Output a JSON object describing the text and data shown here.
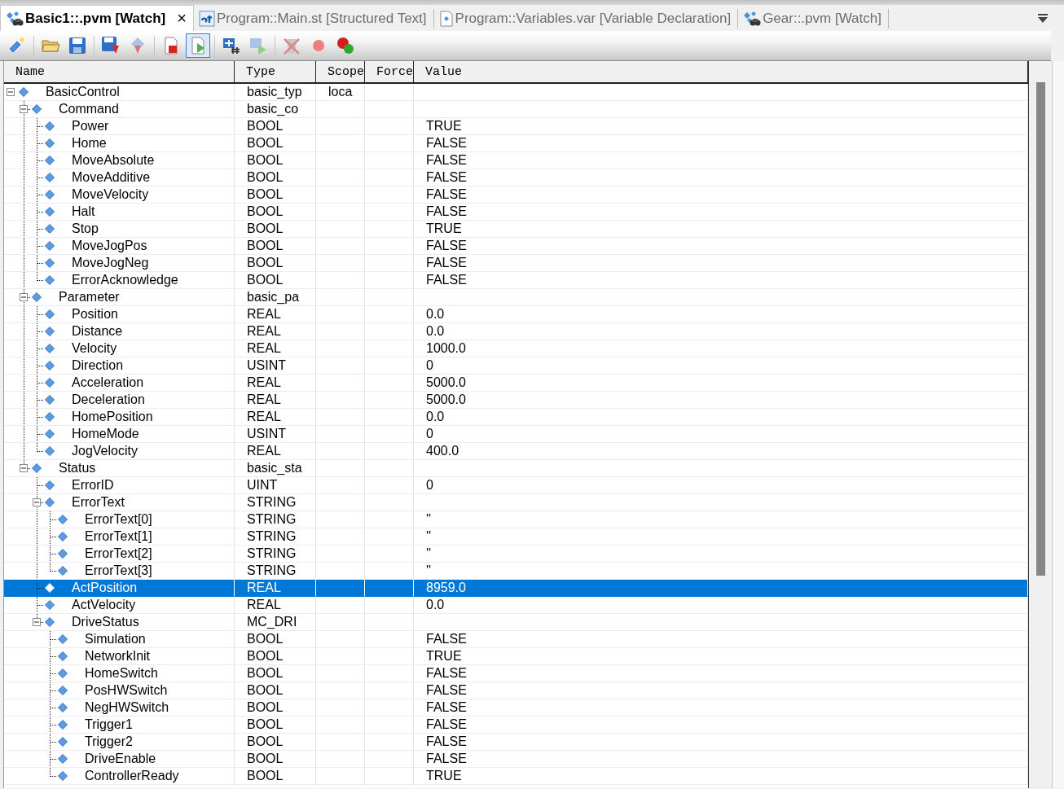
{
  "tabs": [
    {
      "label": "Basic1::.pvm [Watch]",
      "kind": "watch",
      "selected": true,
      "close": "×"
    },
    {
      "label": "Program::Main.st [Structured Text]",
      "kind": "st",
      "selected": false
    },
    {
      "label": "Program::Variables.var [Variable Declaration]",
      "kind": "var",
      "selected": false
    },
    {
      "label": "Gear::.pvm [Watch]",
      "kind": "watch",
      "selected": false
    }
  ],
  "toolbar": [
    {
      "kind": "add-variable",
      "active": false
    },
    {
      "kind": "separator"
    },
    {
      "kind": "open",
      "active": false
    },
    {
      "kind": "save",
      "active": false
    },
    {
      "kind": "separator"
    },
    {
      "kind": "save-down",
      "active": false
    },
    {
      "kind": "download",
      "active": false
    },
    {
      "kind": "separator"
    },
    {
      "kind": "stop-page",
      "active": false
    },
    {
      "kind": "run-page",
      "active": true
    },
    {
      "kind": "separator"
    },
    {
      "kind": "variables",
      "active": false
    },
    {
      "kind": "run-variables",
      "active": false
    },
    {
      "kind": "separator"
    },
    {
      "kind": "delete",
      "active": false
    },
    {
      "kind": "record",
      "active": false
    },
    {
      "kind": "multi",
      "active": false
    }
  ],
  "table": {
    "columns": [
      "Name",
      "Type",
      "Scope",
      "Force",
      "Value"
    ],
    "rows": [
      {
        "name": "BasicControl",
        "type": "basic_typ",
        "scope": "loca",
        "selected": false,
        "expanded": true,
        "children": [
          {
            "name": "Command",
            "type": "basic_co",
            "selected": false,
            "expanded": true,
            "children": [
              {
                "name": "Power",
                "type": "BOOL",
                "value": "TRUE",
                "selected": false
              },
              {
                "name": "Home",
                "type": "BOOL",
                "value": "FALSE",
                "selected": false
              },
              {
                "name": "MoveAbsolute",
                "type": "BOOL",
                "value": "FALSE",
                "selected": false
              },
              {
                "name": "MoveAdditive",
                "type": "BOOL",
                "value": "FALSE",
                "selected": false
              },
              {
                "name": "MoveVelocity",
                "type": "BOOL",
                "value": "FALSE",
                "selected": false
              },
              {
                "name": "Halt",
                "type": "BOOL",
                "value": "FALSE",
                "selected": false
              },
              {
                "name": "Stop",
                "type": "BOOL",
                "value": "TRUE",
                "selected": false
              },
              {
                "name": "MoveJogPos",
                "type": "BOOL",
                "value": "FALSE",
                "selected": false
              },
              {
                "name": "MoveJogNeg",
                "type": "BOOL",
                "value": "FALSE",
                "selected": false
              },
              {
                "name": "ErrorAcknowledge",
                "type": "BOOL",
                "value": "FALSE",
                "selected": false
              }
            ]
          },
          {
            "name": "Parameter",
            "type": "basic_pa",
            "selected": false,
            "expanded": true,
            "children": [
              {
                "name": "Position",
                "type": "REAL",
                "value": "0.0",
                "selected": false
              },
              {
                "name": "Distance",
                "type": "REAL",
                "value": "0.0",
                "selected": false
              },
              {
                "name": "Velocity",
                "type": "REAL",
                "value": "1000.0",
                "selected": false
              },
              {
                "name": "Direction",
                "type": "USINT",
                "value": "0",
                "selected": false
              },
              {
                "name": "Acceleration",
                "type": "REAL",
                "value": "5000.0",
                "selected": false
              },
              {
                "name": "Deceleration",
                "type": "REAL",
                "value": "5000.0",
                "selected": false
              },
              {
                "name": "HomePosition",
                "type": "REAL",
                "value": "0.0",
                "selected": false
              },
              {
                "name": "HomeMode",
                "type": "USINT",
                "value": "0",
                "selected": false
              },
              {
                "name": "JogVelocity",
                "type": "REAL",
                "value": "400.0",
                "selected": false
              }
            ]
          },
          {
            "name": "Status",
            "type": "basic_sta",
            "selected": false,
            "expanded": true,
            "children": [
              {
                "name": "ErrorID",
                "type": "UINT",
                "value": "0",
                "selected": false
              },
              {
                "name": "ErrorText",
                "type": "STRING",
                "selected": false,
                "expanded": true,
                "children": [
                  {
                    "name": "ErrorText[0]",
                    "type": "STRING",
                    "value": "''",
                    "selected": false
                  },
                  {
                    "name": "ErrorText[1]",
                    "type": "STRING",
                    "value": "''",
                    "selected": false
                  },
                  {
                    "name": "ErrorText[2]",
                    "type": "STRING",
                    "value": "''",
                    "selected": false
                  },
                  {
                    "name": "ErrorText[3]",
                    "type": "STRING",
                    "value": "''",
                    "selected": false
                  }
                ]
              },
              {
                "name": "ActPosition",
                "type": "REAL",
                "value": "8959.0",
                "selected": true
              },
              {
                "name": "ActVelocity",
                "type": "REAL",
                "value": "0.0",
                "selected": false
              },
              {
                "name": "DriveStatus",
                "type": "MC_DRI",
                "selected": false,
                "expanded": true,
                "children": [
                  {
                    "name": "Simulation",
                    "type": "BOOL",
                    "value": "FALSE",
                    "selected": false
                  },
                  {
                    "name": "NetworkInit",
                    "type": "BOOL",
                    "value": "TRUE",
                    "selected": false
                  },
                  {
                    "name": "HomeSwitch",
                    "type": "BOOL",
                    "value": "FALSE",
                    "selected": false
                  },
                  {
                    "name": "PosHWSwitch",
                    "type": "BOOL",
                    "value": "FALSE",
                    "selected": false
                  },
                  {
                    "name": "NegHWSwitch",
                    "type": "BOOL",
                    "value": "FALSE",
                    "selected": false
                  },
                  {
                    "name": "Trigger1",
                    "type": "BOOL",
                    "value": "FALSE",
                    "selected": false
                  },
                  {
                    "name": "Trigger2",
                    "type": "BOOL",
                    "value": "FALSE",
                    "selected": false
                  },
                  {
                    "name": "DriveEnable",
                    "type": "BOOL",
                    "value": "FALSE",
                    "selected": false
                  },
                  {
                    "name": "ControllerReady",
                    "type": "BOOL",
                    "value": "TRUE",
                    "selected": false
                  }
                ]
              }
            ]
          }
        ]
      }
    ]
  }
}
